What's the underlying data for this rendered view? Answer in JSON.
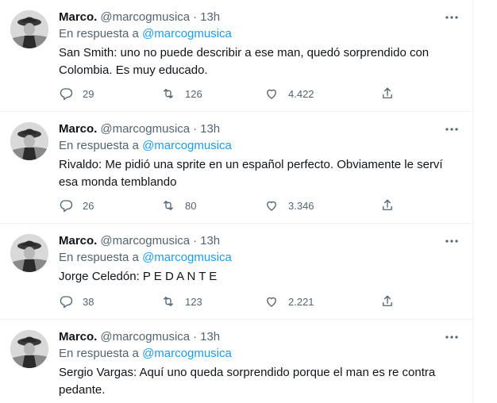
{
  "tweets": [
    {
      "name": "Marco.",
      "handle": "@marcogmusica",
      "separator": "·",
      "time": "13h",
      "reply_prefix": "En respuesta a",
      "reply_to": "@marcogmusica",
      "text": "San Smith: uno no puede describir a ese man, quedó sorprendido con Colombia. Es muy educado.",
      "replies": "29",
      "retweets": "126",
      "likes": "4.422"
    },
    {
      "name": "Marco.",
      "handle": "@marcogmusica",
      "separator": "·",
      "time": "13h",
      "reply_prefix": "En respuesta a",
      "reply_to": "@marcogmusica",
      "text": "Rivaldo: Me pidió una sprite en un español perfecto. Obviamente le serví esa monda temblando",
      "replies": "26",
      "retweets": "80",
      "likes": "3.346"
    },
    {
      "name": "Marco.",
      "handle": "@marcogmusica",
      "separator": "·",
      "time": "13h",
      "reply_prefix": "En respuesta a",
      "reply_to": "@marcogmusica",
      "text": "Jorge Celedón: P E D A N T E",
      "replies": "38",
      "retweets": "123",
      "likes": "2.221"
    },
    {
      "name": "Marco.",
      "handle": "@marcogmusica",
      "separator": "·",
      "time": "13h",
      "reply_prefix": "En respuesta a",
      "reply_to": "@marcogmusica",
      "text": "Sergio Vargas: Aquí uno queda sorprendido porque el man es re contra pedante."
    }
  ],
  "icons": {
    "more": "more-horizontal-icon",
    "reply": "reply-icon",
    "retweet": "retweet-icon",
    "like": "heart-icon",
    "share": "share-icon"
  },
  "colors": {
    "text": "#0f1419",
    "secondary": "#536471",
    "link": "#1d9bf0",
    "border": "#eff3f4"
  }
}
